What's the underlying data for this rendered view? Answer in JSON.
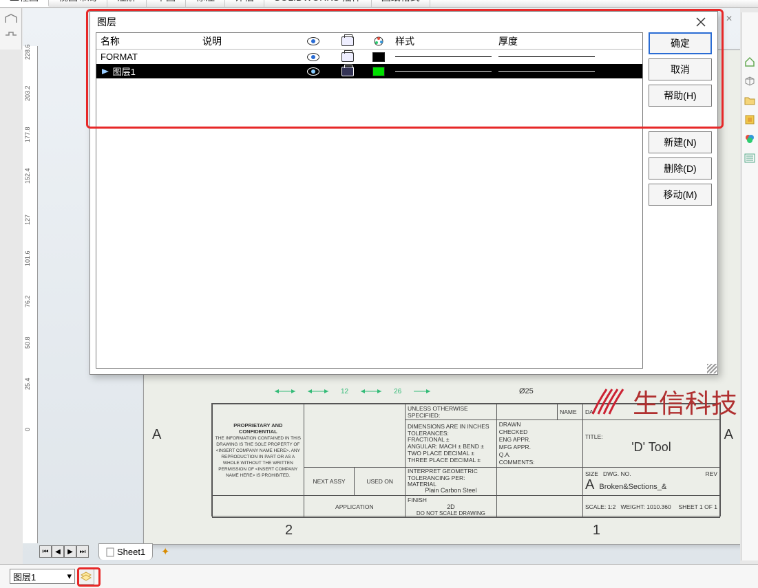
{
  "tabs": {
    "items": [
      "工程图",
      "视图布局",
      "注解",
      "草图",
      "标注",
      "评估",
      "SOLIDWORKS 插件",
      "图纸格式"
    ],
    "active_index": 0
  },
  "right_tools": [
    "home-icon",
    "isometric-icon",
    "folder-icon",
    "appearance-icon",
    "color-icon",
    "list-icon"
  ],
  "ruler_ticks": [
    "228.6",
    "203.2",
    "177.8",
    "152.4",
    "127",
    "101.6",
    "76.2",
    "50.8",
    "25.4",
    "0"
  ],
  "dialog": {
    "title": "图层",
    "columns": {
      "name": "名称",
      "desc": "说明",
      "style": "样式",
      "thickness": "厚度"
    },
    "rows": [
      {
        "name": "FORMAT",
        "desc": "",
        "color": "#000000",
        "selected": false
      },
      {
        "name": "图层1",
        "desc": "",
        "color": "#00e000",
        "selected": true
      }
    ],
    "buttons": {
      "ok": "确定",
      "cancel": "取消",
      "help": "帮助(H)",
      "new": "新建(N)",
      "delete": "删除(D)",
      "move": "移动(M)"
    }
  },
  "drawing": {
    "dims": {
      "d1": "12",
      "d2": "26",
      "dia": "Ø25"
    },
    "edge_letter": "A",
    "bottom_numbers": {
      "left": "2",
      "right": "1"
    },
    "titleblock": {
      "unless": "UNLESS OTHERWISE SPECIFIED:",
      "dim_in": "DIMENSIONS ARE IN INCHES",
      "tol": "TOLERANCES:",
      "frac": "FRACTIONAL ±",
      "ang": "ANGULAR: MACH ±   BEND ±",
      "two": "TWO PLACE DECIMAL   ±",
      "three": "THREE PLACE DECIMAL  ±",
      "interp": "INTERPRET GEOMETRIC",
      "tolper": "TOLERANCING PER:",
      "material": "MATERIAL",
      "material_v": "Plain Carbon Steel",
      "finish": "FINISH",
      "finish_v": "2D",
      "noscale": "DO NOT SCALE DRAWING",
      "prop_hdr": "PROPRIETARY AND CONFIDENTIAL",
      "prop_body": "THE INFORMATION CONTAINED IN THIS DRAWING IS THE SOLE PROPERTY OF <INSERT COMPANY NAME HERE>. ANY REPRODUCTION IN PART OR AS A WHOLE WITHOUT THE WRITTEN PERMISSION OF <INSERT COMPANY NAME HERE> IS PROHIBITED.",
      "nextassy": "NEXT ASSY",
      "usedon": "USED ON",
      "application": "APPLICATION",
      "name": "NAME",
      "date": "DA",
      "drawn": "DRAWN",
      "checked": "CHECKED",
      "engappr": "ENG APPR.",
      "mfgappr": "MFG APPR.",
      "qa": "Q.A.",
      "comments": "COMMENTS:",
      "title_lbl": "TITLE:",
      "title_v": "'D' Tool",
      "size_lbl": "SIZE",
      "size_v": "A",
      "dwgno_lbl": "DWG. NO.",
      "dwgno_v": "Broken&Sections_&",
      "rev_lbl": "REV",
      "scale": "SCALE: 1:2",
      "weight": "WEIGHT: 1010.360",
      "sheet": "SHEET 1 OF 1"
    }
  },
  "bottom": {
    "sheet_tab": "Sheet1",
    "layer_select": "图层1"
  },
  "watermark": {
    "text": "生信科技"
  }
}
